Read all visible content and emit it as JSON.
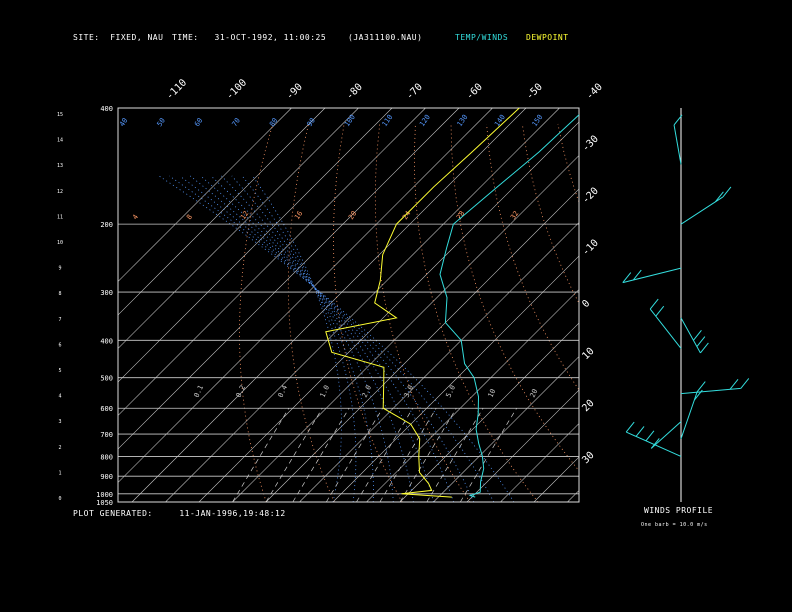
{
  "header": {
    "site_label": "SITE:",
    "site_value": "FIXED, NAU",
    "time_label": "TIME:",
    "time_value": "31-OCT-1992, 11:00:25",
    "file": "(JA311100.NAU)",
    "temp_legend": "TEMP/WINDS",
    "dew_legend": "DEWPOINT"
  },
  "footer": {
    "generated_label": "PLOT GENERATED:",
    "generated_value": "11-JAN-1996,19:48:12"
  },
  "winds": {
    "title": "WINDS PROFILE",
    "note": "One barb = 10.0 m/s"
  },
  "colors": {
    "temp": "#33dddd",
    "dew": "#ffff33",
    "isotherm": "#cccccc",
    "isobar": "#cccccc",
    "dry_adiabat": "#ff9966",
    "moist_adiabat": "#5599ff",
    "mixing_ratio": "#cccccc"
  },
  "chart_data": {
    "type": "line",
    "title": "Skew-T log-P diagram",
    "pressure_axis": {
      "labels": [
        "400",
        "200",
        "300",
        "400",
        "500",
        "600",
        "700",
        "800",
        "900",
        "1000",
        "1050"
      ],
      "levels": [
        100,
        200,
        300,
        400,
        500,
        600,
        700,
        800,
        900,
        1000,
        1050
      ]
    },
    "height_axis_km": [
      "15",
      "14",
      "13",
      "12",
      "11",
      "10",
      "9",
      "8",
      "7",
      "6",
      "5",
      "4",
      "3",
      "2",
      "1",
      "0"
    ],
    "isotherm_top_labels": [
      "-110",
      "-100",
      "-90",
      "-80",
      "-70",
      "-60",
      "-50",
      "-40"
    ],
    "isotherm_right_labels": [
      "-30",
      "-20",
      "-10",
      "0",
      "10",
      "20",
      "30"
    ],
    "moist_adiabat_labels": [
      "40",
      "50",
      "60",
      "70",
      "80",
      "90",
      "100",
      "110",
      "120",
      "130",
      "140",
      "150"
    ],
    "dry_adiabat_labels": [
      "4",
      "8",
      "12",
      "16",
      "20",
      "24",
      "28",
      "32"
    ],
    "mixing_ratio_labels": [
      "0.1",
      "0.2",
      "0.4",
      "1.0",
      "2.0",
      "3.0",
      "5.0",
      "10",
      "20"
    ],
    "series": [
      {
        "name": "TEMP/WINDS",
        "points": [
          [
            -62,
            100
          ],
          [
            -63,
            130
          ],
          [
            -65,
            160
          ],
          [
            -67,
            200
          ],
          [
            -62,
            230
          ],
          [
            -56,
            270
          ],
          [
            -47,
            310
          ],
          [
            -40,
            360
          ],
          [
            -30,
            400
          ],
          [
            -22,
            460
          ],
          [
            -15,
            500
          ],
          [
            -8,
            560
          ],
          [
            -3,
            620
          ],
          [
            1,
            680
          ],
          [
            6,
            740
          ],
          [
            11,
            800
          ],
          [
            15,
            860
          ],
          [
            18,
            930
          ],
          [
            21,
            990
          ],
          [
            19,
            1010
          ],
          [
            21,
            1020
          ]
        ]
      },
      {
        "name": "DEWPOINT",
        "points": [
          [
            -82,
            100
          ],
          [
            -83,
            130
          ],
          [
            -84,
            160
          ],
          [
            -84,
            200
          ],
          [
            -79,
            240
          ],
          [
            -72,
            280
          ],
          [
            -67,
            320
          ],
          [
            -56,
            350
          ],
          [
            -73,
            380
          ],
          [
            -65,
            430
          ],
          [
            -45,
            470
          ],
          [
            -40,
            520
          ],
          [
            -33,
            600
          ],
          [
            -20,
            660
          ],
          [
            -13,
            720
          ],
          [
            -8,
            800
          ],
          [
            -3,
            880
          ],
          [
            3,
            940
          ],
          [
            6,
            980
          ],
          [
            -2,
            1000
          ],
          [
            14,
            1020
          ]
        ]
      }
    ],
    "winds_profile": [
      {
        "p": 140,
        "speed": 10
      },
      {
        "p": 200,
        "speed": 20
      },
      {
        "p": 260,
        "speed": 20
      },
      {
        "p": 350,
        "speed": 30
      },
      {
        "p": 420,
        "speed": 20
      },
      {
        "p": 550,
        "speed": 20
      },
      {
        "p": 650,
        "speed": 10
      },
      {
        "p": 720,
        "speed": 20
      },
      {
        "p": 800,
        "speed": 30
      }
    ]
  }
}
